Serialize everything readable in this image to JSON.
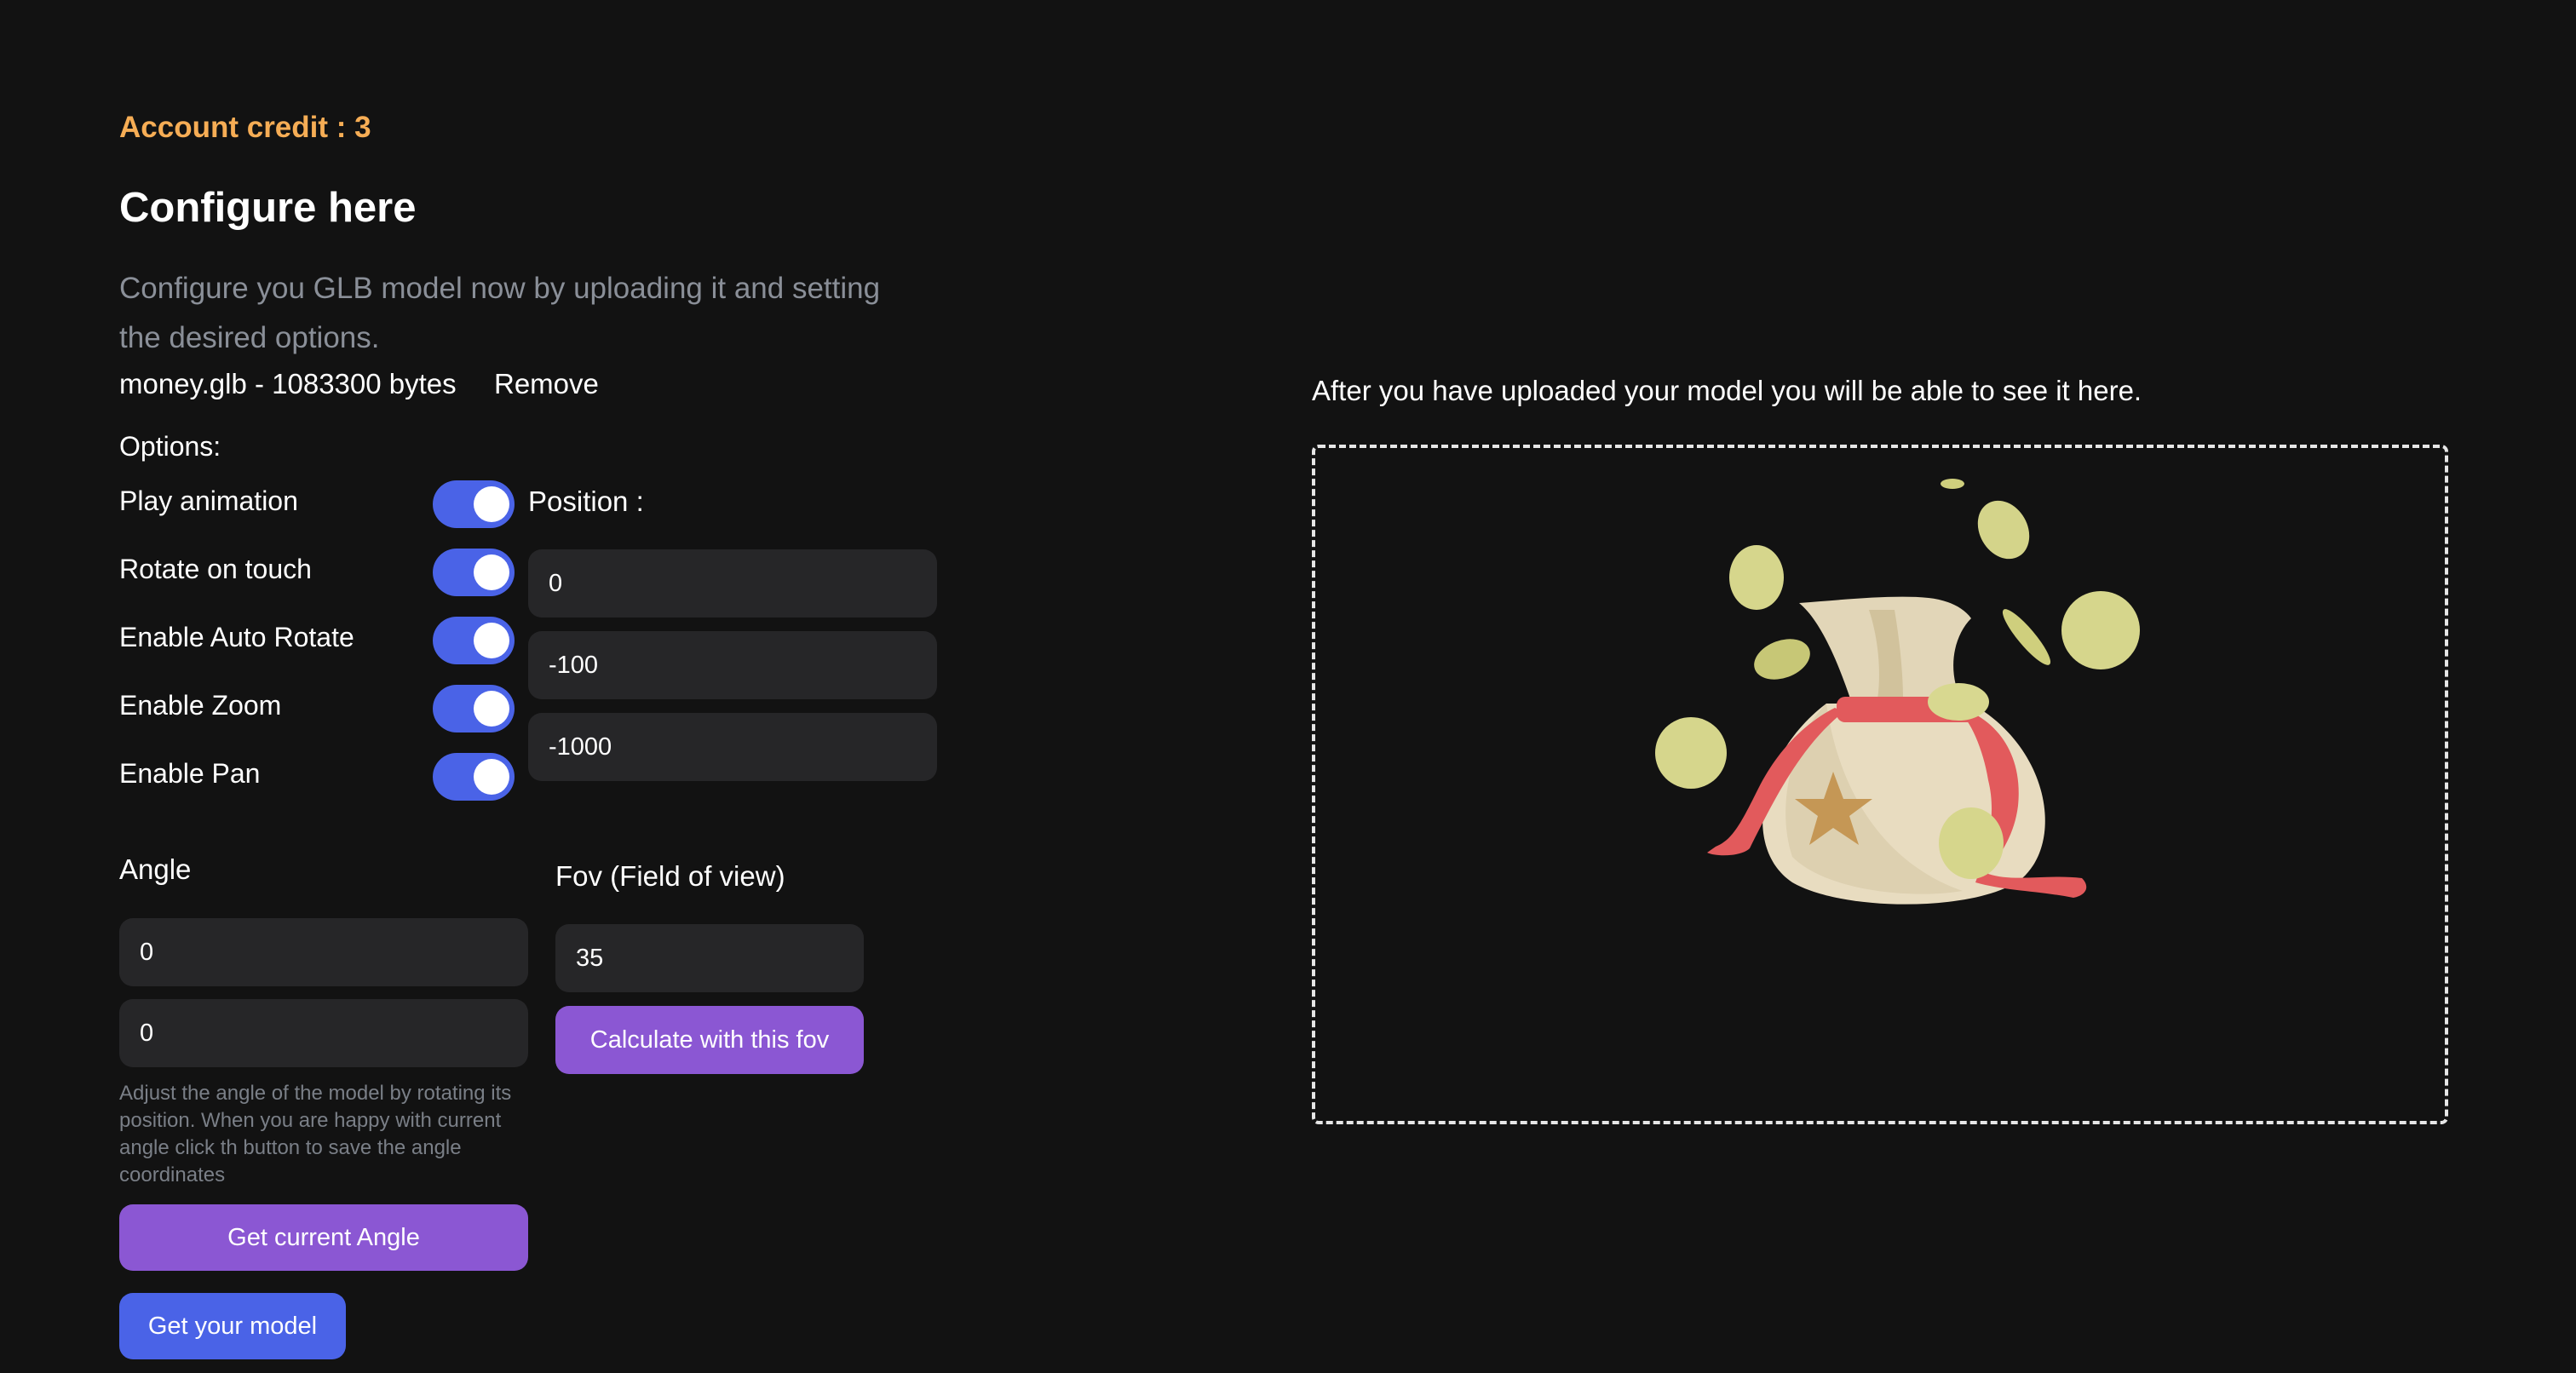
{
  "header": {
    "credit": "Account credit : 3",
    "title": "Configure here",
    "description": "Configure you GLB model now by uploading it and setting the desired options."
  },
  "file": {
    "name": "money.glb - 1083300 bytes",
    "remove_label": "Remove"
  },
  "options": {
    "label": "Options:",
    "toggles": [
      {
        "label": "Play animation",
        "on": true
      },
      {
        "label": "Rotate on touch",
        "on": true
      },
      {
        "label": "Enable Auto Rotate",
        "on": true
      },
      {
        "label": "Enable Zoom",
        "on": true
      },
      {
        "label": "Enable Pan",
        "on": true
      }
    ]
  },
  "position": {
    "label": "Position :",
    "x": "0",
    "y": "-100",
    "z": "-1000"
  },
  "angle": {
    "label": "Angle",
    "a": "0",
    "b": "0",
    "help": "Adjust the angle of the model by rotating its position. When you are happy with current angle click th button to save the angle coordinates",
    "button": "Get current Angle"
  },
  "fov": {
    "label": "Fov (Field of view)",
    "value": "35",
    "button": "Calculate with this fov"
  },
  "actions": {
    "get_model": "Get your model"
  },
  "viewer": {
    "caption": "After you have uploaded your model you will be able to see it here.",
    "model_icon": "money-bag-icon"
  },
  "colors": {
    "background": "#121212",
    "accent_orange": "#f6ad55",
    "toggle_blue": "#4a63e7",
    "button_purple": "#8b57d3",
    "input_bg": "#262628"
  }
}
